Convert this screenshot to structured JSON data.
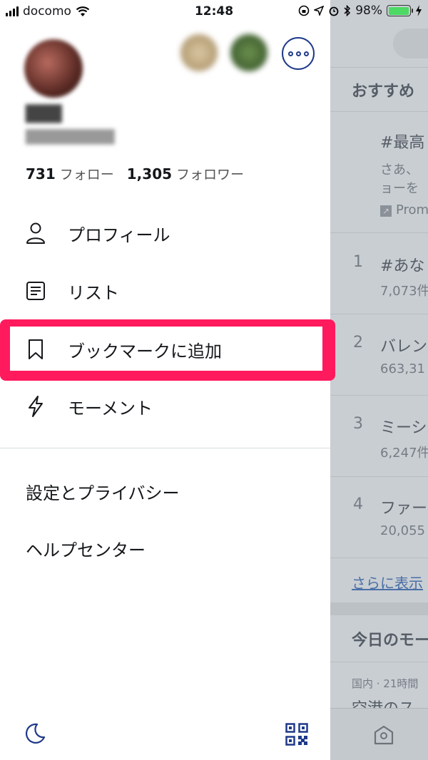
{
  "status_bar": {
    "carrier": "docomo",
    "time": "12:48",
    "battery_percent": "98%",
    "battery_level": 0.98
  },
  "drawer": {
    "following_count": "731",
    "following_label": "フォロー",
    "followers_count": "1,305",
    "followers_label": "フォロワー",
    "menu": [
      {
        "label": "プロフィール",
        "icon": "person-icon"
      },
      {
        "label": "リスト",
        "icon": "list-icon"
      },
      {
        "label": "ブックマークに追加",
        "icon": "bookmark-icon"
      },
      {
        "label": "モーメント",
        "icon": "lightning-icon"
      }
    ],
    "settings_label": "設定とプライバシー",
    "help_label": "ヘルプセンター"
  },
  "background": {
    "recommended_title": "おすすめ",
    "promoted_title": "#最高",
    "promoted_desc_1": "さあ、",
    "promoted_desc_2": "ョーを",
    "promoted_tag": "Prom",
    "trends": [
      {
        "rank": "1",
        "title": "#あな",
        "count": "7,073件"
      },
      {
        "rank": "2",
        "title": "バレン",
        "count": "663,31"
      },
      {
        "rank": "3",
        "title": "ミーシ",
        "count": "6,247件"
      },
      {
        "rank": "4",
        "title": "ファー",
        "count": "20,055"
      }
    ],
    "show_more": "さらに表示",
    "moments_title": "今日のモー",
    "moments_meta": "国内 · 21時間",
    "moments_headline": "空港のス"
  },
  "colors": {
    "highlight": "#ff1a5e",
    "accent": "#1f3a8a",
    "battery": "#4cd964"
  }
}
